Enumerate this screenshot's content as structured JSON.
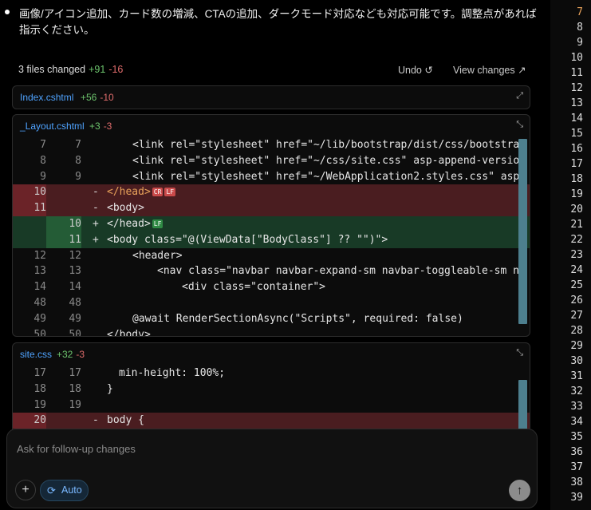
{
  "message": "画像/アイコン追加、カード数の増減、CTAの追加、ダークモード対応なども対応可能です。調整点があれば指示ください。",
  "summary": {
    "files": "3 files changed",
    "add": "+91",
    "del": "-16"
  },
  "actions": {
    "undo": "Undo",
    "view_changes": "View changes"
  },
  "files": [
    {
      "name": "Index.cshtml",
      "add": "+56",
      "del": "-10"
    },
    {
      "name": "_Layout.cshtml",
      "add": "+3",
      "del": "-3"
    },
    {
      "name": "site.css",
      "add": "+32",
      "del": "-3"
    }
  ],
  "layout_rows": [
    {
      "old": "7",
      "new": "7",
      "type": "ctx"
    },
    {
      "old": "8",
      "new": "8",
      "type": "ctx"
    },
    {
      "old": "9",
      "new": "9",
      "type": "ctx"
    },
    {
      "old": "10",
      "new": "",
      "type": "del"
    },
    {
      "old": "11",
      "new": "",
      "type": "del"
    },
    {
      "old": "",
      "new": "10",
      "type": "add"
    },
    {
      "old": "",
      "new": "11",
      "type": "add"
    },
    {
      "old": "12",
      "new": "12",
      "type": "ctx"
    },
    {
      "old": "13",
      "new": "13",
      "type": "ctx"
    },
    {
      "old": "14",
      "new": "14",
      "type": "ctx"
    },
    {
      "old": "48",
      "new": "48",
      "type": "ctx"
    },
    {
      "old": "49",
      "new": "49",
      "type": "ctx"
    },
    {
      "old": "50",
      "new": "50",
      "type": "ctx"
    }
  ],
  "css_rows": [
    {
      "old": "17",
      "new": "17",
      "type": "ctx"
    },
    {
      "old": "18",
      "new": "18",
      "type": "ctx"
    },
    {
      "old": "19",
      "new": "19",
      "type": "ctx"
    },
    {
      "old": "20",
      "new": "",
      "type": "del"
    }
  ],
  "code": {
    "l7": "<link rel=\"stylesheet\" href=\"~/lib/bootstrap/dist/css/bootstrap",
    "l8": "<link rel=\"stylesheet\" href=\"~/css/site.css\" asp-append-version",
    "l9": "<link rel=\"stylesheet\" href=\"~/WebApplication2.styles.css\" asp-",
    "d10": "</head>",
    "d11": "<body>",
    "a10": "</head>",
    "a11": "<body class=\"@(ViewData[\"BodyClass\"] ?? \"\")\">",
    "l12": "<header>",
    "l13": "<nav class=\"navbar navbar-expand-sm navbar-toggleable-sm na",
    "l14": "<div class=\"container\">",
    "l49": "@await RenderSectionAsync(\"Scripts\", required: false)",
    "l50": "</body>",
    "c17": "min-height: 100%;",
    "c18": "}",
    "c20": "body {"
  },
  "eol": {
    "cr": "CR",
    "lf": "LF"
  },
  "composer": {
    "placeholder": "Ask for follow-up changes",
    "mode": "Auto"
  },
  "gutter_lines": [
    "7",
    "8",
    "9",
    "10",
    "11",
    "12",
    "13",
    "14",
    "15",
    "16",
    "17",
    "18",
    "19",
    "20",
    "21",
    "22",
    "23",
    "24",
    "25",
    "26",
    "27",
    "28",
    "29",
    "30",
    "31",
    "32",
    "33",
    "34",
    "35",
    "36",
    "37",
    "38",
    "39"
  ],
  "colors": {
    "add": "#6dc46d",
    "del": "#e06c6c",
    "link": "#4fa3ff",
    "accent": "#e8a25a"
  }
}
